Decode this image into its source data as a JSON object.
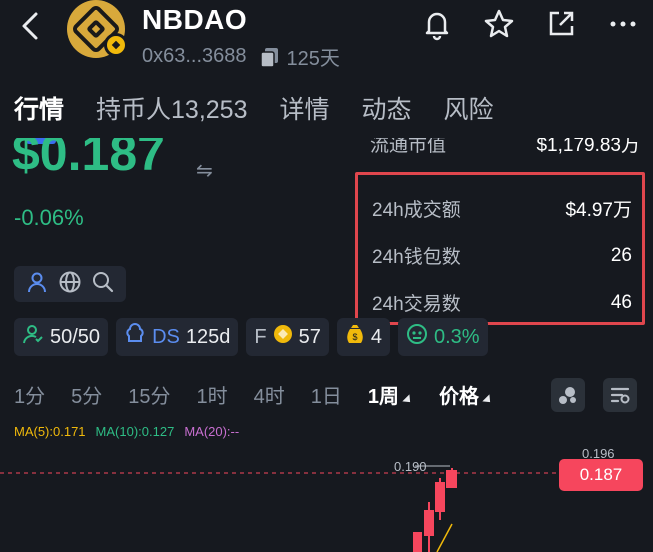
{
  "header": {
    "token_name": "NBDAO",
    "address": "0x63...3688",
    "age": "125天"
  },
  "tabs": [
    "行情",
    "持币人13,253",
    "详情",
    "动态",
    "风险"
  ],
  "price": {
    "value": "$0.187",
    "change": "-0.06%"
  },
  "stats": {
    "circulating_label": "流通市值",
    "circulating_value": "$1,179.83万",
    "volume_label": "24h成交额",
    "volume_value": "$4.97万",
    "wallets_label": "24h钱包数",
    "wallets_value": "26",
    "trades_label": "24h交易数",
    "trades_value": "46"
  },
  "chips": {
    "score": "50/50",
    "ds_label": "DS",
    "ds_value": "125d",
    "f_label": "F",
    "f_value": "57",
    "bag_value": "4",
    "face_value": "0.3%"
  },
  "timeframes": [
    "1分",
    "5分",
    "15分",
    "1时",
    "4时",
    "1日",
    "1周",
    "价格"
  ],
  "ma": {
    "ma5": "MA(5):0.171",
    "ma10": "MA(10):0.127",
    "ma20": "MA(20):--"
  },
  "chart": {
    "high_label": "0.196",
    "mid_label": "0.190",
    "current_price": "0.187"
  },
  "colors": {
    "up": "#2ebd85",
    "down": "#f6465d",
    "accent": "#3a6df0",
    "highlight": "#e0464d"
  }
}
